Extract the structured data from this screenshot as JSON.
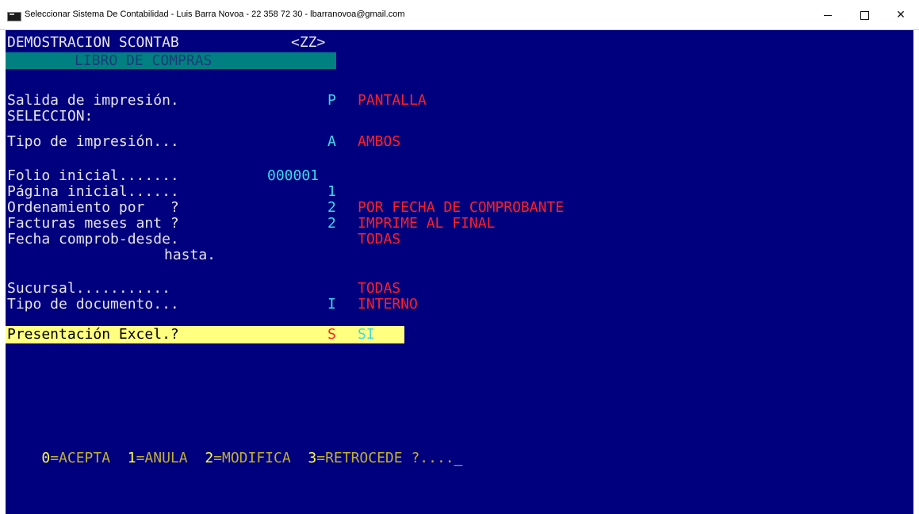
{
  "window": {
    "title": "Seleccionar Sistema De Contabilidad - Luis Barra Novoa - 22 358 72 30 - lbarranovoa@gmail.com",
    "minimize_icon": "minimize-icon",
    "maximize_icon": "maximize-icon",
    "close_icon": "close-icon",
    "close_glyph": "✕"
  },
  "header": {
    "company": "DEMOSTRACION SCONTAB",
    "code": "<ZZ>",
    "report": "LIBRO DE COMPRAS"
  },
  "fields": [
    {
      "label": "Salida de impresión.",
      "value": "P",
      "desc": "PANTALLA"
    },
    {
      "label": "SELECCION:",
      "value": "",
      "desc": ""
    },
    {
      "label": "Tipo de impresión...",
      "value": "A",
      "desc": "AMBOS"
    },
    {
      "label": "Folio inicial.......",
      "value": "000001",
      "desc": ""
    },
    {
      "label": "Página inicial......",
      "value": "1",
      "desc": ""
    },
    {
      "label": "Ordenamiento por   ?",
      "value": "2",
      "desc": "POR FECHA DE COMPROBANTE"
    },
    {
      "label": "Facturas meses ant ?",
      "value": "2",
      "desc": "IMPRIME AL FINAL"
    },
    {
      "label": "Fecha comprob-desde.",
      "value": "",
      "desc": "TODAS"
    },
    {
      "label": "hasta.",
      "value": "",
      "desc": ""
    },
    {
      "label": "Sucursal...........",
      "value": "",
      "desc": "TODAS"
    },
    {
      "label": "Tipo de documento...",
      "value": "I",
      "desc": "INTERNO"
    },
    {
      "label": "Presentación Excel.?",
      "value": "S",
      "desc": "SI"
    }
  ],
  "footer": {
    "opt0_key": "0",
    "opt0_label": "=ACEPTA",
    "opt1_key": "1",
    "opt1_label": "=ANULA",
    "opt2_key": "2",
    "opt2_label": "=MODIFICA",
    "opt3_key": "3",
    "opt3_label": "=RETROCEDE ?....",
    "cursor": "_"
  },
  "colors": {
    "console_bg": "#00007f",
    "header_bar": "#008080",
    "highlight_bar": "#ffff80",
    "value_cyan": "#3fd8e8",
    "desc_red": "#ff2020",
    "footer_olive": "#c0b030",
    "footer_key_yellow": "#ffff40"
  }
}
